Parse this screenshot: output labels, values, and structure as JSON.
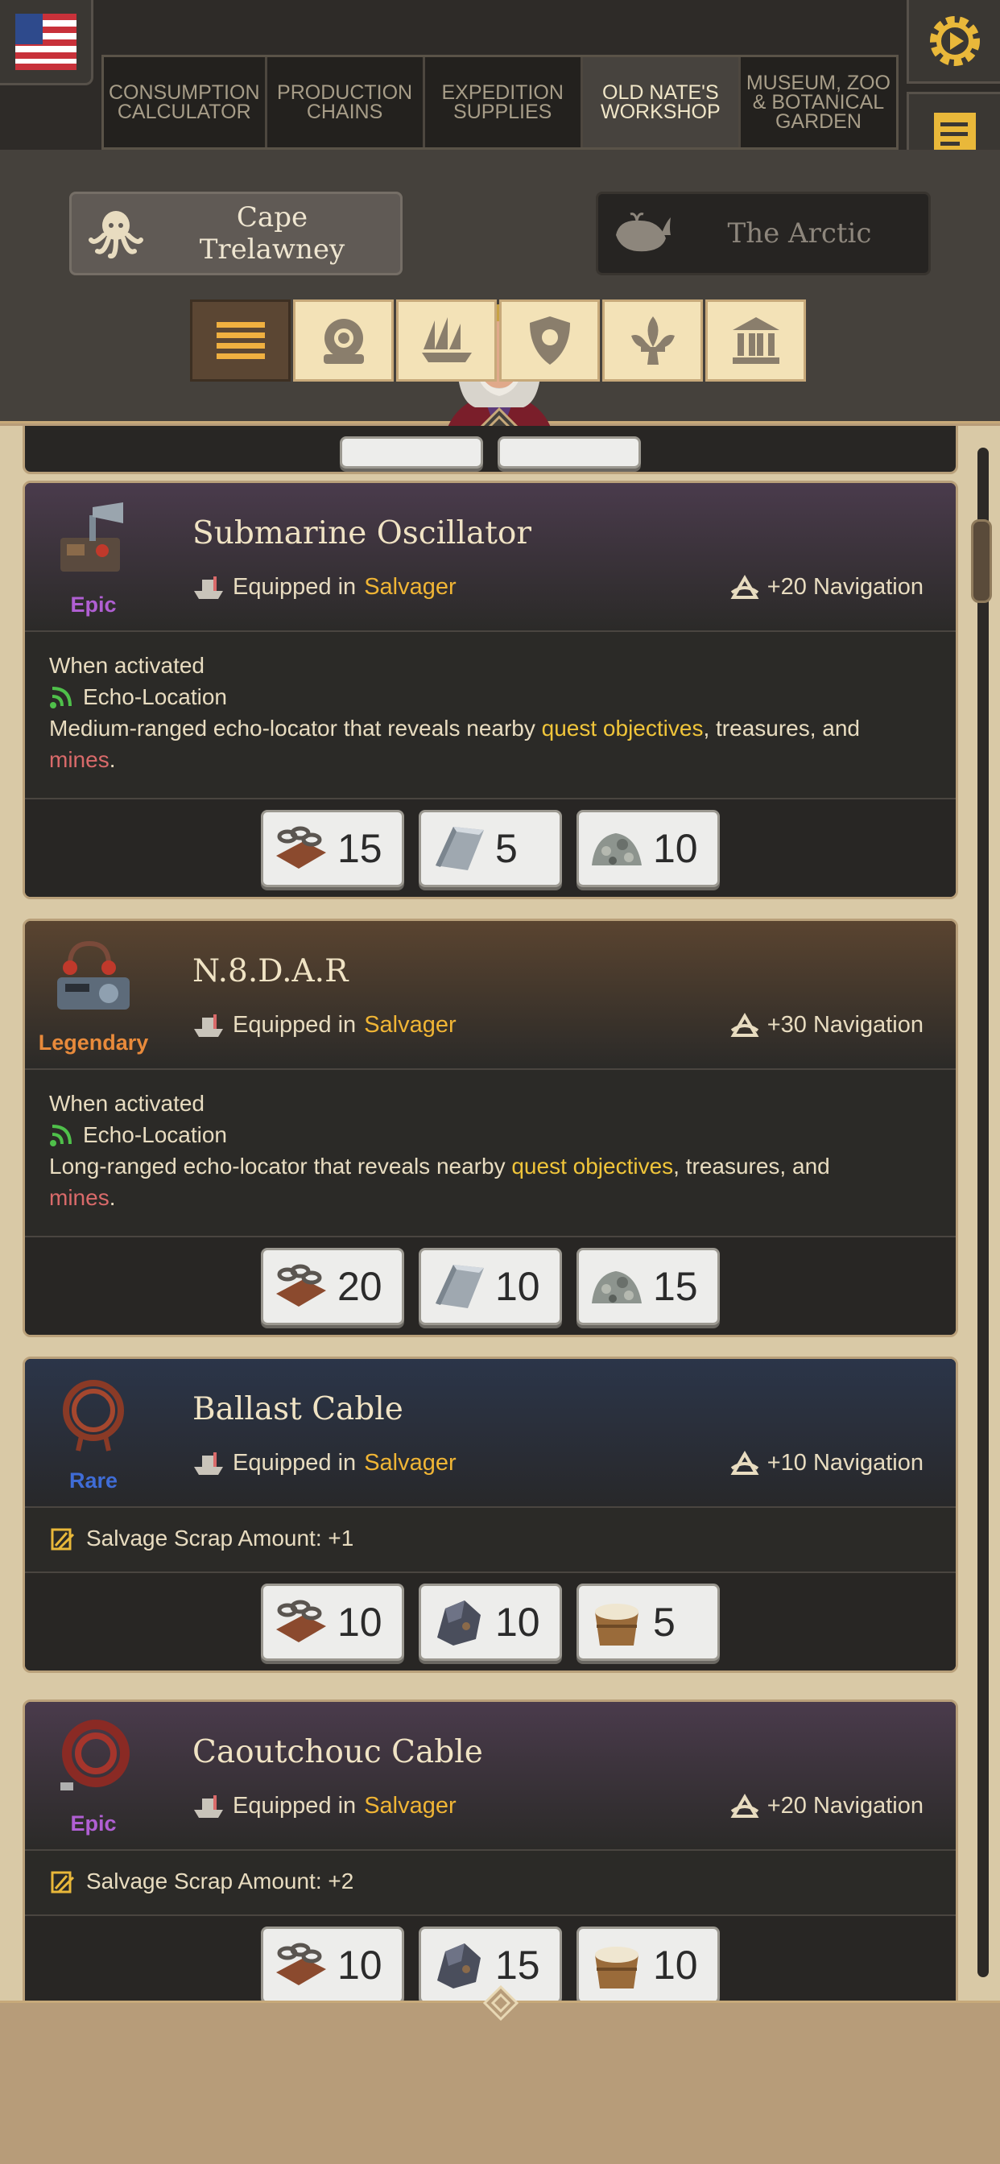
{
  "tabs": [
    {
      "label": "Consumption Calculator",
      "active": false
    },
    {
      "label": "Production Chains",
      "active": false
    },
    {
      "label": "Expedition Supplies",
      "active": false
    },
    {
      "label": "Old Nate's Workshop",
      "active": true
    },
    {
      "label": "Museum, Zoo & Botanical Garden",
      "active": false
    }
  ],
  "regions": {
    "left": "Cape Trelawney",
    "right": "The Arctic"
  },
  "cards": [
    {
      "name": "Submarine Oscillator",
      "rarity": "Epic",
      "equipped_label": "Equipped in",
      "ship": "Salvager",
      "stat": "+20 Navigation",
      "activation": "When activated",
      "ability": "Echo-Location",
      "desc_pre": "Medium-ranged echo-locator that reveals nearby ",
      "desc_hl1": "quest objectives",
      "desc_mid": ", treasures, and",
      "desc_hl2": "mines",
      "desc_end": ".",
      "costs": [
        {
          "icon": "chain-icon",
          "value": "15"
        },
        {
          "icon": "steel-ingot-icon",
          "value": "5"
        },
        {
          "icon": "scrap-pile-icon",
          "value": "10"
        }
      ]
    },
    {
      "name": "N.8.D.A.R",
      "rarity": "Legendary",
      "equipped_label": "Equipped in",
      "ship": "Salvager",
      "stat": "+30 Navigation",
      "activation": "When activated",
      "ability": "Echo-Location",
      "desc_pre": "Long-ranged echo-locator that reveals nearby ",
      "desc_hl1": "quest objectives",
      "desc_mid": ", treasures, and",
      "desc_hl2": "mines",
      "desc_end": ".",
      "costs": [
        {
          "icon": "chain-icon",
          "value": "20"
        },
        {
          "icon": "steel-ingot-icon",
          "value": "10"
        },
        {
          "icon": "scrap-pile-icon",
          "value": "15"
        }
      ]
    },
    {
      "name": "Ballast Cable",
      "rarity": "Rare",
      "equipped_label": "Equipped in",
      "ship": "Salvager",
      "stat": "+10 Navigation",
      "effect": "Salvage Scrap Amount: +1",
      "costs": [
        {
          "icon": "chain-icon",
          "value": "10"
        },
        {
          "icon": "ore-icon",
          "value": "10"
        },
        {
          "icon": "flour-bucket-icon",
          "value": "5"
        }
      ]
    },
    {
      "name": "Caoutchouc Cable",
      "rarity": "Epic",
      "equipped_label": "Equipped in",
      "ship": "Salvager",
      "stat": "+20 Navigation",
      "effect": "Salvage Scrap Amount: +2",
      "costs": [
        {
          "icon": "chain-icon",
          "value": "10"
        },
        {
          "icon": "ore-icon",
          "value": "15"
        },
        {
          "icon": "flour-bucket-icon",
          "value": "10"
        }
      ]
    }
  ]
}
